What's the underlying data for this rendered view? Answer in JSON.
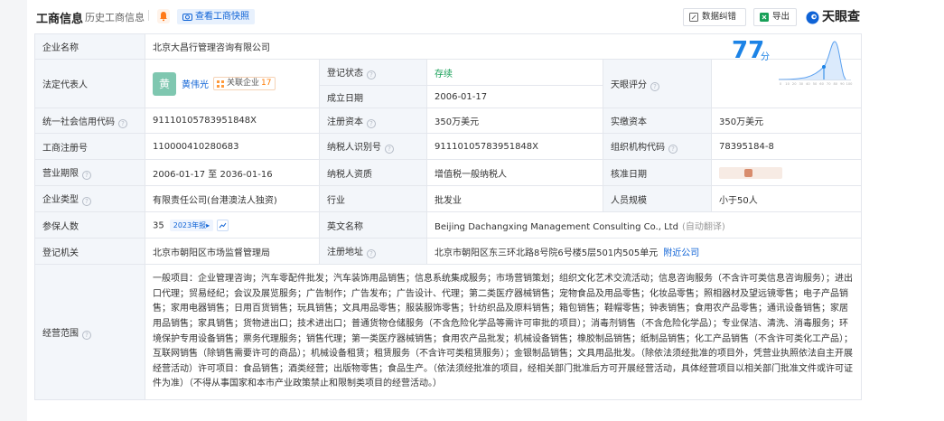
{
  "header": {
    "title": "工商信息",
    "history_link": "历史工商信息",
    "snapshot_btn": "查看工商快照",
    "fix_btn": "数据纠错",
    "export_btn": "导出",
    "logo_text": "天眼查"
  },
  "colors": {
    "accent": "#0f63d6",
    "status_green": "#18a058",
    "label_bg": "#f3f6fa",
    "score": "#1c83e6"
  },
  "company": {
    "name_label": "企业名称",
    "name": "北京大昌行管理咨询有限公司",
    "legal_label": "法定代表人",
    "legal_avatar": "黄",
    "legal_name": "黄伟光",
    "related_label": "关联企业",
    "related_count": "17",
    "status_label": "登记状态",
    "status": "存续",
    "found_label": "成立日期",
    "found_date": "2006-01-17",
    "score_label": "天眼评分",
    "score": "77",
    "score_unit": "分",
    "score_ticks": [
      "0",
      "10",
      "20",
      "30",
      "40",
      "50",
      "60",
      "70",
      "80",
      "90",
      "100"
    ],
    "credit_label": "统一社会信用代码",
    "credit_code": "91110105783951848X",
    "reg_capital_label": "注册资本",
    "reg_capital": "350万美元",
    "paid_capital_label": "实缴资本",
    "paid_capital": "350万美元",
    "reg_no_label": "工商注册号",
    "reg_no": "110000410280683",
    "taxpayer_id_label": "纳税人识别号",
    "taxpayer_id": "91110105783951848X",
    "org_code_label": "组织机构代码",
    "org_code": "78395184-8",
    "term_label": "营业期限",
    "term": "2006-01-17 至 2036-01-16",
    "tax_quality_label": "纳税人资质",
    "tax_quality": "增值税一般纳税人",
    "approve_label": "核准日期",
    "type_label": "企业类型",
    "type": "有限责任公司(台港澳法人独资)",
    "industry_label": "行业",
    "industry": "批发业",
    "staff_label": "人员规模",
    "staff": "小于50人",
    "insured_label": "参保人数",
    "insured": "35",
    "report_tag": "2023年报",
    "english_label": "英文名称",
    "english_name": "Beijing Dachangxing Management Consulting Co., Ltd",
    "auto_translate": "(自动翻译)",
    "authority_label": "登记机关",
    "authority": "北京市朝阳区市场监督管理局",
    "address_label": "注册地址",
    "address": "北京市朝阳区东三环北路8号院6号楼5层501内505单元",
    "nearby_link": "附近公司",
    "scope_label": "经营范围",
    "scope": "一般项目：企业管理咨询；汽车零配件批发；汽车装饰用品销售；信息系统集成服务；市场营销策划；组织文化艺术交流活动；信息咨询服务（不含许可类信息咨询服务）；进出口代理；贸易经纪；会议及展览服务；广告制作；广告发布；广告设计、代理；第二类医疗器械销售；宠物食品及用品零售；化妆品零售；照相器材及望远镜零售；电子产品销售；家用电器销售；日用百货销售；玩具销售；文具用品零售；服装服饰零售；针纺织品及原料销售；箱包销售；鞋帽零售；钟表销售；食用农产品零售；通讯设备销售；家居用品销售；家具销售；货物进出口；技术进出口；普通货物仓储服务（不含危险化学品等需许可审批的项目）；消毒剂销售（不含危险化学品）；专业保洁、清洗、消毒服务；环境保护专用设备销售；票务代理服务；销售代理；第一类医疗器械销售；食用农产品批发；机械设备销售；橡胶制品销售；纸制品销售；化工产品销售（不含许可类化工产品）；互联网销售（除销售需要许可的商品）；机械设备租赁；租赁服务（不含许可类租赁服务）；金银制品销售；文具用品批发。（除依法须经批准的项目外，凭营业执照依法自主开展经营活动）许可项目：食品销售；酒类经营；出版物零售；食品生产。（依法须经批准的项目，经相关部门批准后方可开展经营活动，具体经营项目以相关部门批准文件或许可证件为准）（不得从事国家和本市产业政策禁止和限制类项目的经营活动。）"
  }
}
